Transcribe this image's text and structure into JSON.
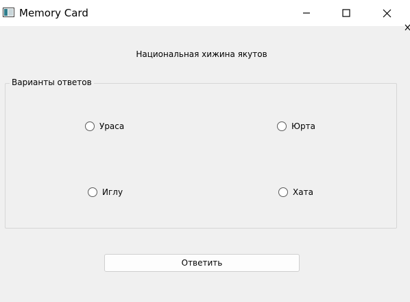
{
  "window": {
    "title": "Memory Card",
    "icon": "app-window-icon",
    "controls": [
      "minimize-icon",
      "maximize-icon",
      "close-icon"
    ]
  },
  "question": {
    "text": "Национальная хижина якутов"
  },
  "answers_group": {
    "title": "Варианты ответов",
    "options": [
      {
        "label": "Ураса",
        "checked": false
      },
      {
        "label": "Юрта",
        "checked": false
      },
      {
        "label": "Иглу",
        "checked": false
      },
      {
        "label": "Хата",
        "checked": false
      }
    ]
  },
  "submit": {
    "label": "Ответить"
  },
  "colors": {
    "window_bg": "#f0f0f0",
    "titlebar_bg": "#ffffff",
    "border": "#d6d6d6"
  }
}
